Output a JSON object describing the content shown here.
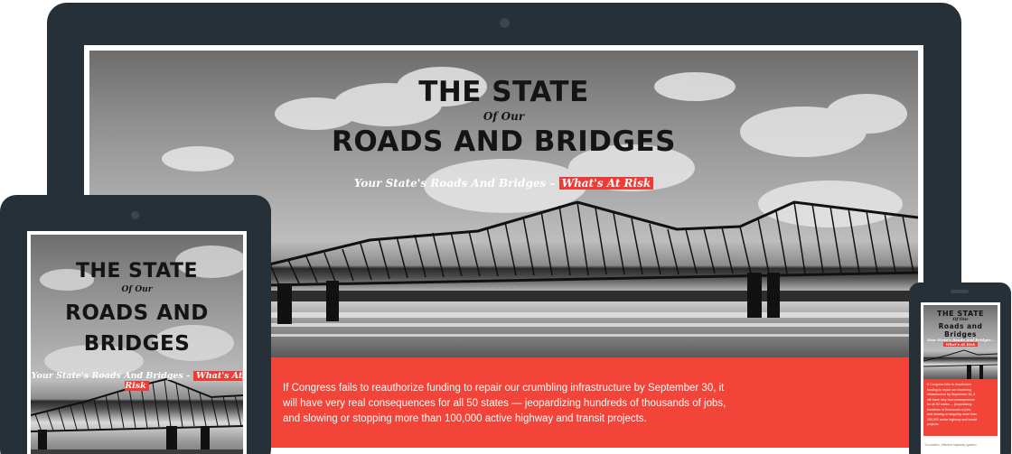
{
  "page": {
    "title_line1": "THE STATE",
    "title_line2": "Of Our",
    "title_line3": "ROADS AND BRIDGES",
    "tagline_prefix": "Your State's Roads And Bridges – ",
    "tagline_highlight": "What's At Risk",
    "intro_text": "If Congress fails to reauthorize funding to repair our crumbling infrastructure by September 30, it will have very real consequences for all 50 states — jeopardizing hundreds of thousands of jobs, and slowing or stopping more than 100,000 active highway and transit projects.",
    "secondary_text": "\"A modern, efficient highway system"
  },
  "tablet": {
    "title_line3a": "ROADS AND",
    "title_line3b": "BRIDGES"
  },
  "phone": {
    "title_line3": "Roads and Bridges",
    "tagline_prefix": "Your State's Roads And Bridges – "
  },
  "colors": {
    "device_frame": "#263038",
    "accent_red": "#f24438",
    "highlight_red": "#ee3b35"
  },
  "icons": {
    "camera": "camera-dot-icon",
    "speaker": "speaker-slot-icon"
  }
}
